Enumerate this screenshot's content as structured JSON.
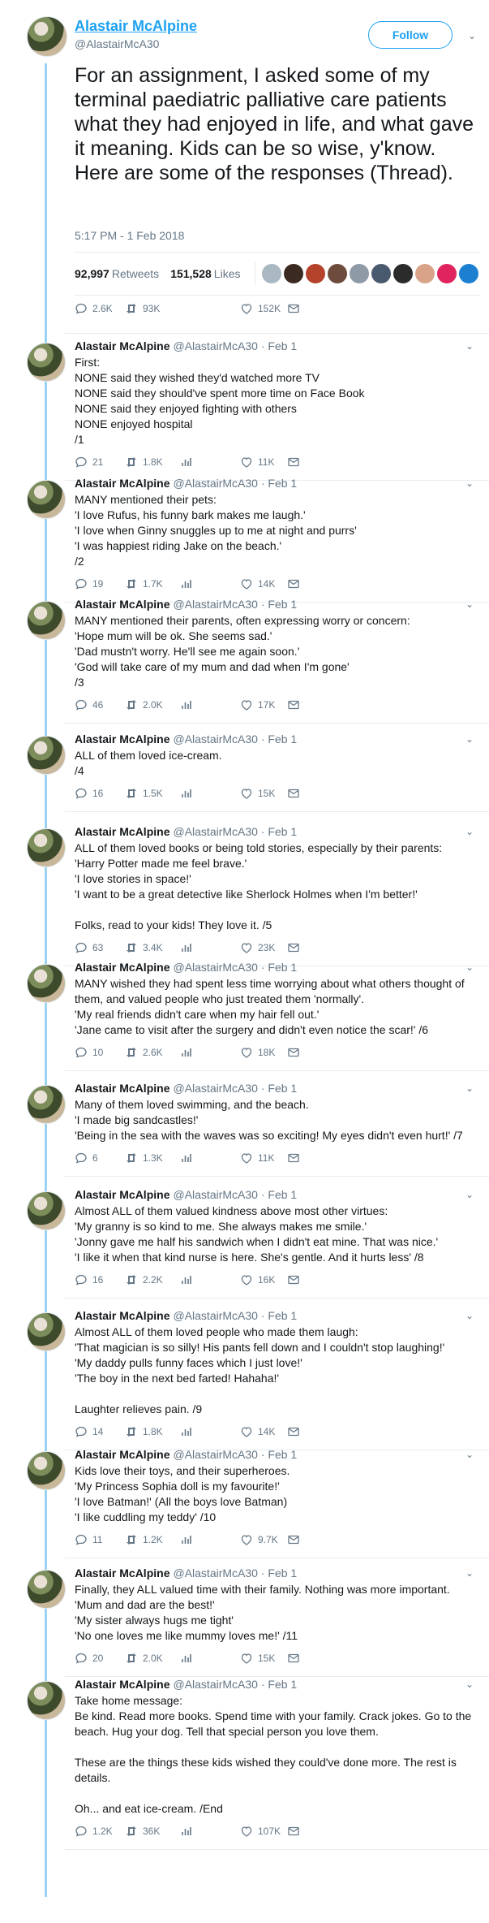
{
  "author": {
    "name": "Alastair McAlpine",
    "handle": "@AlastairMcA30"
  },
  "follow_label": "Follow",
  "main_tweet": {
    "text": "For an assignment, I asked some of my terminal paediatric palliative care patients what they had enjoyed in life, and what gave it meaning. Kids can be so wise, y'know. Here are some of the responses (Thread).",
    "timestamp": "5:17 PM - 1 Feb 2018",
    "retweets_count": "92,997",
    "retweets_label": "Retweets",
    "likes_count": "151,528",
    "likes_label": "Likes",
    "replies": "2.6K",
    "retweets": "93K",
    "likes": "152K"
  },
  "reply_meta": "@AlastairMcA30 · Feb 1",
  "tweets": [
    {
      "text": "First:\nNONE said they wished they'd watched more TV\nNONE said they should've spent more time on Face Book\nNONE said they enjoyed fighting with others\nNONE enjoyed hospital\n/1",
      "replies": "21",
      "retweets": "1.8K",
      "likes": "11K"
    },
    {
      "text": "MANY mentioned their pets:\n'I love Rufus, his funny bark makes me laugh.'\n'I love when Ginny snuggles up to me at night and purrs'\n'I was happiest riding Jake on the beach.'\n/2",
      "replies": "19",
      "retweets": "1.7K",
      "likes": "14K"
    },
    {
      "text": "MANY mentioned their parents, often expressing worry or concern:\n'Hope mum will be ok. She seems sad.'\n'Dad mustn't worry. He'll see me again soon.'\n'God will take care of my mum and dad when I'm gone'\n/3",
      "replies": "46",
      "retweets": "2.0K",
      "likes": "17K"
    },
    {
      "text": "ALL of them loved ice-cream.\n/4",
      "replies": "16",
      "retweets": "1.5K",
      "likes": "15K"
    },
    {
      "text": "ALL of them loved books or being told stories, especially by their parents:\n'Harry Potter made me feel brave.'\n'I love stories in space!'\n'I want to be a great detective like Sherlock Holmes when I'm better!'\n\nFolks, read to your kids! They love it. /5",
      "replies": "63",
      "retweets": "3.4K",
      "likes": "23K"
    },
    {
      "text": "MANY wished they had spent less time worrying about what others thought of them, and valued people who just treated them 'normally'.\n'My real friends didn't care when my hair fell out.'\n'Jane came to visit after the surgery and didn't even notice the scar!' /6",
      "replies": "10",
      "retweets": "2.6K",
      "likes": "18K"
    },
    {
      "text": "Many of them loved swimming, and the beach.\n'I made big sandcastles!'\n'Being in the sea with the waves was so exciting! My eyes didn't even hurt!' /7",
      "replies": "6",
      "retweets": "1.3K",
      "likes": "11K"
    },
    {
      "text": "Almost ALL of them valued kindness above most other virtues:\n'My granny is so kind to me. She always makes me smile.'\n'Jonny gave me half his sandwich when I didn't eat mine. That was nice.'\n'I like it when that kind nurse is here. She's gentle. And it hurts less' /8",
      "replies": "16",
      "retweets": "2.2K",
      "likes": "16K"
    },
    {
      "text": "Almost ALL of them loved people who made them laugh:\n'That magician is so silly! His pants fell down and I couldn't stop laughing!'\n'My daddy pulls funny faces which I just love!'\n'The boy in the next bed farted! Hahaha!'\n\nLaughter relieves pain. /9",
      "replies": "14",
      "retweets": "1.8K",
      "likes": "14K"
    },
    {
      "text": "Kids love their toys, and their superheroes.\n'My Princess Sophia doll is my favourite!'\n'I love Batman!' (All the boys love Batman)\n'I like cuddling my teddy' /10",
      "replies": "11",
      "retweets": "1.2K",
      "likes": "9.7K"
    },
    {
      "text": "Finally, they ALL valued time with their family. Nothing was more important.\n'Mum and dad are the best!'\n'My sister always hugs me tight'\n'No one loves me like mummy loves me!' /11",
      "replies": "20",
      "retweets": "2.0K",
      "likes": "15K"
    },
    {
      "text": "Take home message:\nBe kind. Read more books. Spend time with your family. Crack jokes. Go to the beach. Hug your dog. Tell that special person you love them.\n\nThese are the things these kids wished they could've done more. The rest is details.\n\nOh... and eat ice-cream. /End",
      "replies": "1.2K",
      "retweets": "36K",
      "likes": "107K"
    }
  ],
  "colors": {
    "accent": "#1da1f2",
    "text": "#14171a",
    "muted": "#657786",
    "thread_line": "#9bd3f2",
    "divider": "#e6ecf0"
  },
  "icons": [
    "reply-icon",
    "retweet-icon",
    "like-icon",
    "message-icon",
    "chevron-down-icon",
    "chart-icon"
  ]
}
